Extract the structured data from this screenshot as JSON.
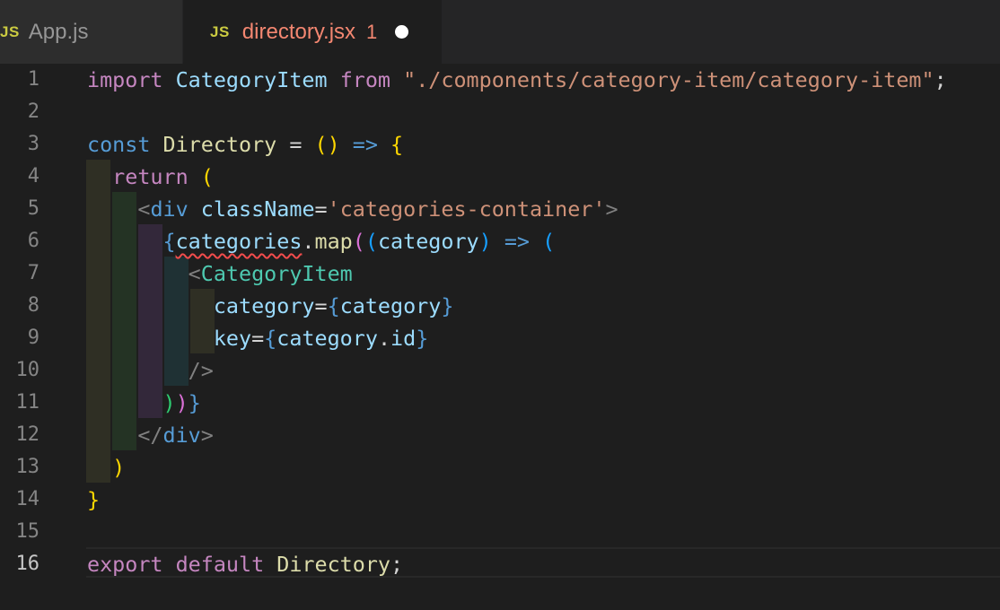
{
  "tabs": [
    {
      "icon": "JS",
      "label": "App.js",
      "active": false
    },
    {
      "icon": "JS",
      "label": "directory.jsx",
      "problems": "1",
      "modified": true,
      "active": true
    }
  ],
  "editor": {
    "current_line": 16,
    "line_numbers": [
      "1",
      "2",
      "3",
      "4",
      "5",
      "6",
      "7",
      "8",
      "9",
      "10",
      "11",
      "12",
      "13",
      "14",
      "15",
      "16"
    ],
    "lines": [
      [
        {
          "t": "import",
          "c": "kw"
        },
        {
          "t": " ",
          "c": "txt"
        },
        {
          "t": "CategoryItem",
          "c": "ident"
        },
        {
          "t": " ",
          "c": "txt"
        },
        {
          "t": "from",
          "c": "kw"
        },
        {
          "t": " ",
          "c": "txt"
        },
        {
          "t": "\"./components/category-item/category-item\"",
          "c": "str"
        },
        {
          "t": ";",
          "c": "txt"
        }
      ],
      [],
      [
        {
          "t": "const",
          "c": "kwb"
        },
        {
          "t": " ",
          "c": "txt"
        },
        {
          "t": "Directory",
          "c": "fn"
        },
        {
          "t": " = ",
          "c": "txt"
        },
        {
          "t": "()",
          "c": "b1"
        },
        {
          "t": " ",
          "c": "txt"
        },
        {
          "t": "=>",
          "c": "kwb"
        },
        {
          "t": " ",
          "c": "txt"
        },
        {
          "t": "{",
          "c": "b1"
        }
      ],
      [
        {
          "t": "  ",
          "c": "txt"
        },
        {
          "t": "return",
          "c": "kw"
        },
        {
          "t": " ",
          "c": "txt"
        },
        {
          "t": "(",
          "c": "b1"
        }
      ],
      [
        {
          "t": "    ",
          "c": "txt"
        },
        {
          "t": "<",
          "c": "punc"
        },
        {
          "t": "div",
          "c": "tag"
        },
        {
          "t": " ",
          "c": "txt"
        },
        {
          "t": "className",
          "c": "ident"
        },
        {
          "t": "=",
          "c": "txt"
        },
        {
          "t": "'categories-container'",
          "c": "str"
        },
        {
          "t": ">",
          "c": "punc"
        }
      ],
      [
        {
          "t": "      ",
          "c": "txt"
        },
        {
          "t": "{",
          "c": "kwb"
        },
        {
          "t": "categories",
          "c": "ident",
          "err": true
        },
        {
          "t": ".",
          "c": "txt"
        },
        {
          "t": "map",
          "c": "fn"
        },
        {
          "t": "(",
          "c": "b2"
        },
        {
          "t": "(",
          "c": "b3"
        },
        {
          "t": "category",
          "c": "ident"
        },
        {
          "t": ")",
          "c": "b3"
        },
        {
          "t": " ",
          "c": "txt"
        },
        {
          "t": "=>",
          "c": "kwb"
        },
        {
          "t": " ",
          "c": "txt"
        },
        {
          "t": "(",
          "c": "b3"
        }
      ],
      [
        {
          "t": "        ",
          "c": "txt"
        },
        {
          "t": "<",
          "c": "punc"
        },
        {
          "t": "CategoryItem",
          "c": "comp"
        }
      ],
      [
        {
          "t": "          ",
          "c": "txt"
        },
        {
          "t": "category",
          "c": "ident"
        },
        {
          "t": "=",
          "c": "txt"
        },
        {
          "t": "{",
          "c": "kwb"
        },
        {
          "t": "category",
          "c": "ident"
        },
        {
          "t": "}",
          "c": "kwb"
        }
      ],
      [
        {
          "t": "          ",
          "c": "txt"
        },
        {
          "t": "key",
          "c": "ident"
        },
        {
          "t": "=",
          "c": "txt"
        },
        {
          "t": "{",
          "c": "kwb"
        },
        {
          "t": "category",
          "c": "ident"
        },
        {
          "t": ".",
          "c": "txt"
        },
        {
          "t": "id",
          "c": "ident"
        },
        {
          "t": "}",
          "c": "kwb"
        }
      ],
      [
        {
          "t": "        ",
          "c": "txt"
        },
        {
          "t": "/>",
          "c": "punc"
        }
      ],
      [
        {
          "t": "      ",
          "c": "txt"
        },
        {
          "t": ")",
          "c": "b4"
        },
        {
          "t": ")",
          "c": "b2"
        },
        {
          "t": "}",
          "c": "kwb"
        }
      ],
      [
        {
          "t": "    ",
          "c": "txt"
        },
        {
          "t": "</",
          "c": "punc"
        },
        {
          "t": "div",
          "c": "tag"
        },
        {
          "t": ">",
          "c": "punc"
        }
      ],
      [
        {
          "t": "  ",
          "c": "txt"
        },
        {
          "t": ")",
          "c": "b1"
        }
      ],
      [
        {
          "t": "}",
          "c": "b1"
        }
      ],
      [],
      [
        {
          "t": "export",
          "c": "kw"
        },
        {
          "t": " ",
          "c": "txt"
        },
        {
          "t": "default",
          "c": "kw"
        },
        {
          "t": " ",
          "c": "txt"
        },
        {
          "t": "Directory",
          "c": "fn"
        },
        {
          "t": ";",
          "c": "txt"
        }
      ]
    ]
  },
  "colors": {
    "editor_bg": "#1e1e1e",
    "tabbar_bg": "#252526",
    "modified_tab_label": "#f48771",
    "error_underline": "#f14c4c"
  }
}
